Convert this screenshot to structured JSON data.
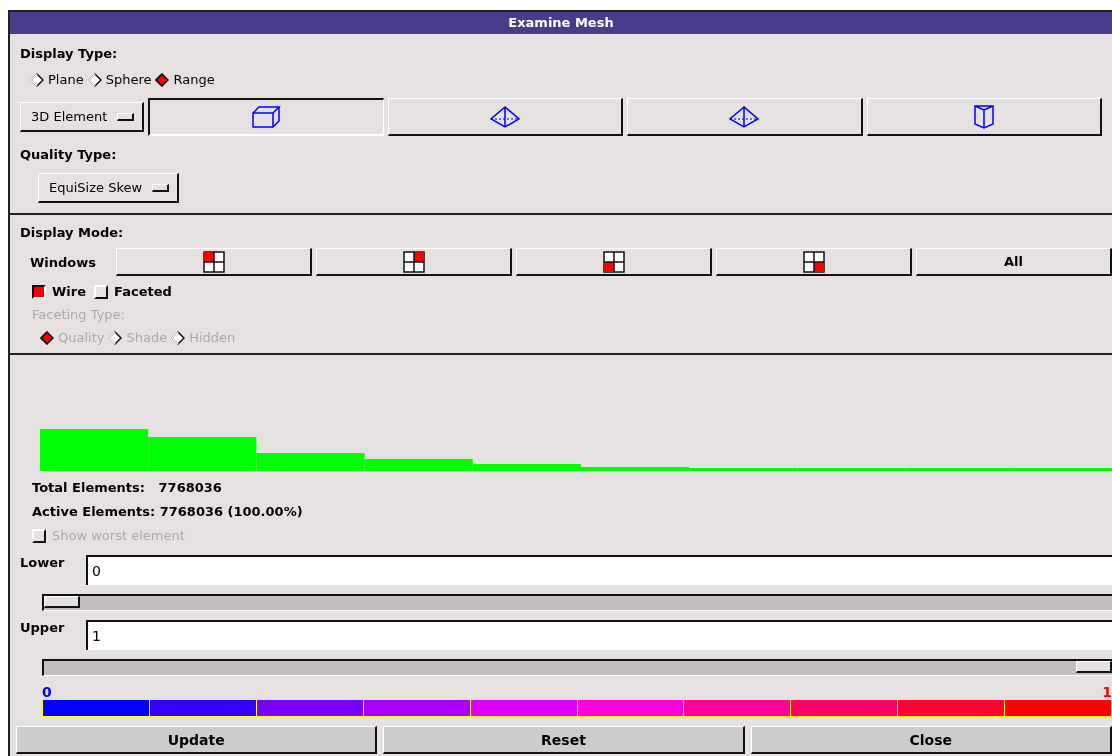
{
  "window": {
    "title": "Examine Mesh"
  },
  "display_type": {
    "label": "Display Type:",
    "options": [
      {
        "label": "Plane",
        "selected": false
      },
      {
        "label": "Sphere",
        "selected": false
      },
      {
        "label": "Range",
        "selected": true
      }
    ]
  },
  "element_menu": {
    "value": "3D Element"
  },
  "element_types": [
    {
      "kind": "hexahedron",
      "selected": true
    },
    {
      "kind": "pyramid",
      "selected": false
    },
    {
      "kind": "tetrahedron",
      "selected": false
    },
    {
      "kind": "wedge",
      "selected": false
    }
  ],
  "quality_type": {
    "label": "Quality Type:",
    "value": "EquiSize Skew"
  },
  "display_mode": {
    "label": "Display Mode:",
    "windows_label": "Windows",
    "windows": [
      {
        "kind": "topleft"
      },
      {
        "kind": "topright"
      },
      {
        "kind": "bottomleft"
      },
      {
        "kind": "bottomright"
      },
      {
        "kind": "text",
        "label": "All"
      }
    ],
    "checks": [
      {
        "label": "Wire",
        "checked": true
      },
      {
        "label": "Faceted",
        "checked": false
      }
    ],
    "faceting": {
      "label": "Faceting Type:",
      "disabled": true,
      "options": [
        {
          "label": "Quality",
          "selected": true
        },
        {
          "label": "Shade",
          "selected": false
        },
        {
          "label": "Hidden",
          "selected": false
        }
      ]
    }
  },
  "stats": {
    "total": "Total Elements:   7768036",
    "active": "Active Elements: 7768036 (100.00%)",
    "show_worst": {
      "label": "Show worst element",
      "checked": false,
      "disabled": true
    }
  },
  "lower": {
    "label": "Lower",
    "value": "0",
    "level": 0
  },
  "upper": {
    "label": "Upper",
    "value": "1",
    "level": 1
  },
  "colorbar": {
    "min": "0",
    "max": "1",
    "segments": [
      {
        "color": "#0000ff"
      },
      {
        "color": "#3300ff"
      },
      {
        "color": "#7700ff"
      },
      {
        "color": "#aa00ff"
      },
      {
        "color": "#dd00ff"
      },
      {
        "color": "#ff00dd"
      },
      {
        "color": "#ff0099"
      },
      {
        "color": "#ff0066"
      },
      {
        "color": "#ff0033"
      },
      {
        "color": "#ff0000"
      }
    ]
  },
  "buttons": [
    "Update",
    "Reset",
    "Close"
  ]
}
